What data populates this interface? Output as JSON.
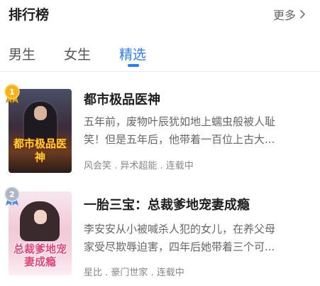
{
  "header": {
    "title": "排行榜",
    "more_label": "更多"
  },
  "tabs": [
    {
      "label": "男生",
      "active": false
    },
    {
      "label": "女生",
      "active": false
    },
    {
      "label": "精选",
      "active": true
    }
  ],
  "colors": {
    "accent": "#2f7df6",
    "rank_1": "#f5b21a",
    "rank_2": "#aeb8c4"
  },
  "books": [
    {
      "rank": "1",
      "title": "都市极品医神",
      "cover_text": "都市极品医神",
      "desc_line1": "五年前，废物叶辰犹如地上蠕虫般被人耻",
      "desc_line2": "笑！但是五年后，他带着一百位上古大...",
      "meta": "风会笑 . 异术超能 . 连载中"
    },
    {
      "rank": "2",
      "title": "一胎三宝：总裁爹地宠妻成瘾",
      "cover_text": "总裁爹地宠妻成瘾",
      "desc_line1": "李安安从小被喊杀人犯的女儿，在养父母",
      "desc_line2": "家受尽欺辱迫害，四年后她带着三个可...",
      "meta": "星比 . 豪门世家 . 连载中"
    }
  ]
}
